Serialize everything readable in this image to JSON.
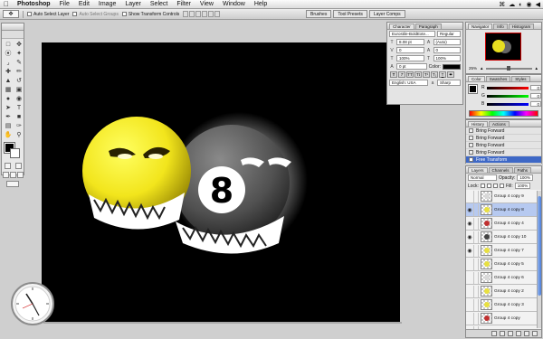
{
  "menubar": {
    "app_name": "Photoshop",
    "items": [
      "File",
      "Edit",
      "Image",
      "Layer",
      "Select",
      "Filter",
      "View",
      "Window",
      "Help"
    ],
    "right_glyphs": [
      "⌘",
      "☁",
      "◐",
      "◉",
      "◀"
    ]
  },
  "options_bar": {
    "auto_select_layer": "Auto Select Layer",
    "auto_select_groups": "Auto Select Groups",
    "show_transform_controls": "Show Transform Controls",
    "dock_tabs": [
      "Brushes",
      "Tool Presets",
      "Layer Comps"
    ]
  },
  "character_panel": {
    "tabs": [
      "Character",
      "Paragraph"
    ],
    "font_family": "Eurostile-BoldExte...",
    "font_style": "Regular",
    "font_size": "8.08 pt",
    "leading": "(Auto)",
    "kerning": "0",
    "tracking": "0",
    "vertical_scale": "100%",
    "horizontal_scale": "100%",
    "baseline_shift": "0 pt",
    "color_label": "Color:",
    "language": "English: USA",
    "anti_alias": "Sharp",
    "type_buttons": [
      "T",
      "T",
      "TT",
      "Tt",
      "T¹",
      "T₁",
      "T",
      "T"
    ]
  },
  "navigator": {
    "tabs": [
      "Navigator",
      "Info",
      "Histogram"
    ],
    "zoom": "25%"
  },
  "color_panel": {
    "tabs": [
      "Color",
      "Swatches",
      "Styles"
    ],
    "channels": [
      {
        "label": "R",
        "value": "0",
        "color": "#d02020"
      },
      {
        "label": "G",
        "value": "0",
        "color": "#20a020"
      },
      {
        "label": "B",
        "value": "0",
        "color": "#2040d0"
      }
    ]
  },
  "history_panel": {
    "tabs": [
      "History",
      "Actions"
    ],
    "items": [
      "Bring Forward",
      "Bring Forward",
      "Bring Forward",
      "Bring Forward",
      "Free Transform"
    ],
    "active_index": 4
  },
  "layers_panel": {
    "tabs": [
      "Layers",
      "Channels",
      "Paths"
    ],
    "blend_mode": "Normal",
    "opacity_label": "Opacity:",
    "opacity": "100%",
    "lock_label": "Lock:",
    "fill_label": "Fill:",
    "fill": "100%",
    "layers": [
      {
        "name": "Group 4 copy 9",
        "visible": false,
        "thumb": "#d8d8d8"
      },
      {
        "name": "Group 4 copy 8",
        "visible": true,
        "thumb": "#e8e040",
        "selected": true
      },
      {
        "name": "Group 4 copy 4",
        "visible": true,
        "thumb": "#c03030"
      },
      {
        "name": "Group 4 copy 10",
        "visible": true,
        "thumb": "#444444"
      },
      {
        "name": "Group 4 copy 7",
        "visible": true,
        "thumb": "#e8e040"
      },
      {
        "name": "Group 4 copy 5",
        "visible": false,
        "thumb": "#e8e040"
      },
      {
        "name": "Group 4 copy 6",
        "visible": false,
        "thumb": "#d8d8d8"
      },
      {
        "name": "Group 4 copy 2",
        "visible": false,
        "thumb": "#e8e040"
      },
      {
        "name": "Group 4 copy 3",
        "visible": false,
        "thumb": "#e8e040"
      },
      {
        "name": "Group 4 copy",
        "visible": false,
        "thumb": "#c03030"
      },
      {
        "name": "Group 4",
        "visible": false,
        "folder": true
      }
    ]
  },
  "canvas": {
    "ball_number": "8",
    "ball_color": "#f2e51c",
    "eight_ball_color": "#666666"
  },
  "colors": {
    "accent": "#3e68c6",
    "canvas_bg": "#000000"
  }
}
